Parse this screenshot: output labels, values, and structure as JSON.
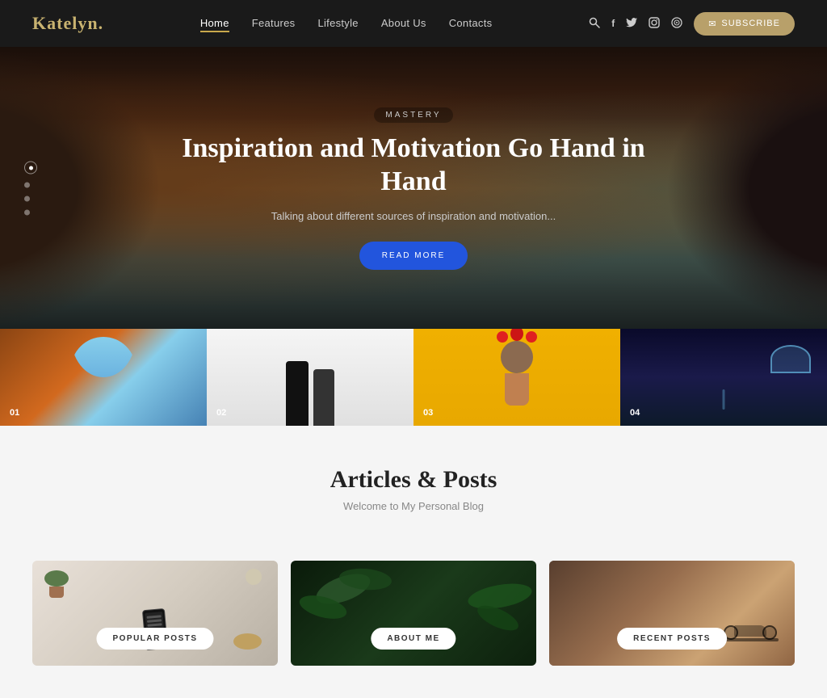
{
  "brand": {
    "name": "Katelyn",
    "dot": "."
  },
  "nav": {
    "items": [
      {
        "label": "Home",
        "active": true
      },
      {
        "label": "Features",
        "active": false
      },
      {
        "label": "Lifestyle",
        "active": false
      },
      {
        "label": "About Us",
        "active": false
      },
      {
        "label": "Contacts",
        "active": false
      }
    ]
  },
  "subscribe_btn": "Subscribe",
  "hero": {
    "label": "MASTERY",
    "title": "Inspiration and Motivation Go Hand in Hand",
    "subtitle": "Talking about different sources of inspiration and motivation...",
    "cta": "READ MORE",
    "dots": [
      "dot1",
      "dot2",
      "dot3",
      "dot4"
    ]
  },
  "thumbnails": [
    {
      "num": "01"
    },
    {
      "num": "02"
    },
    {
      "num": "03"
    },
    {
      "num": "04"
    }
  ],
  "articles": {
    "title": "Articles & Posts",
    "subtitle": "Welcome to My Personal Blog"
  },
  "blog_cards": [
    {
      "label": "POPULAR POSTS"
    },
    {
      "label": "ABOUT ME"
    },
    {
      "label": "RECENT POSTS"
    }
  ],
  "icons": {
    "search": "🔍",
    "facebook": "f",
    "twitter": "t",
    "instagram": "◎",
    "rss": "◉",
    "subscribe_arrow": "✉"
  }
}
